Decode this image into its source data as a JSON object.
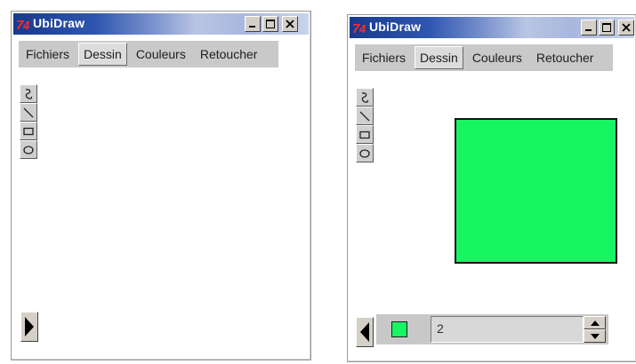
{
  "window_left": {
    "title": "UbiDraw",
    "menu": [
      {
        "label": "Fichiers",
        "active": false
      },
      {
        "label": "Dessin",
        "active": true
      },
      {
        "label": "Couleurs",
        "active": false
      },
      {
        "label": "Retoucher",
        "active": false
      }
    ],
    "tools": [
      "freehand-tool-icon",
      "line-tool-icon",
      "rectangle-tool-icon",
      "ellipse-tool-icon"
    ],
    "panel_arrow": "right"
  },
  "window_right": {
    "title": "UbiDraw",
    "menu": [
      {
        "label": "Fichiers",
        "active": false
      },
      {
        "label": "Dessin",
        "active": true
      },
      {
        "label": "Couleurs",
        "active": false
      },
      {
        "label": "Retoucher",
        "active": false
      }
    ],
    "tools": [
      "freehand-tool-icon",
      "line-tool-icon",
      "rectangle-tool-icon",
      "ellipse-tool-icon"
    ],
    "panel_arrow": "left",
    "shape": {
      "type": "rectangle",
      "fill": "#17f563",
      "stroke": "#111111"
    },
    "status": {
      "color": "#17f563",
      "line_width": "2"
    }
  },
  "colors": {
    "title_dark": "#183a8c",
    "canvas_fill": "#17f563"
  }
}
